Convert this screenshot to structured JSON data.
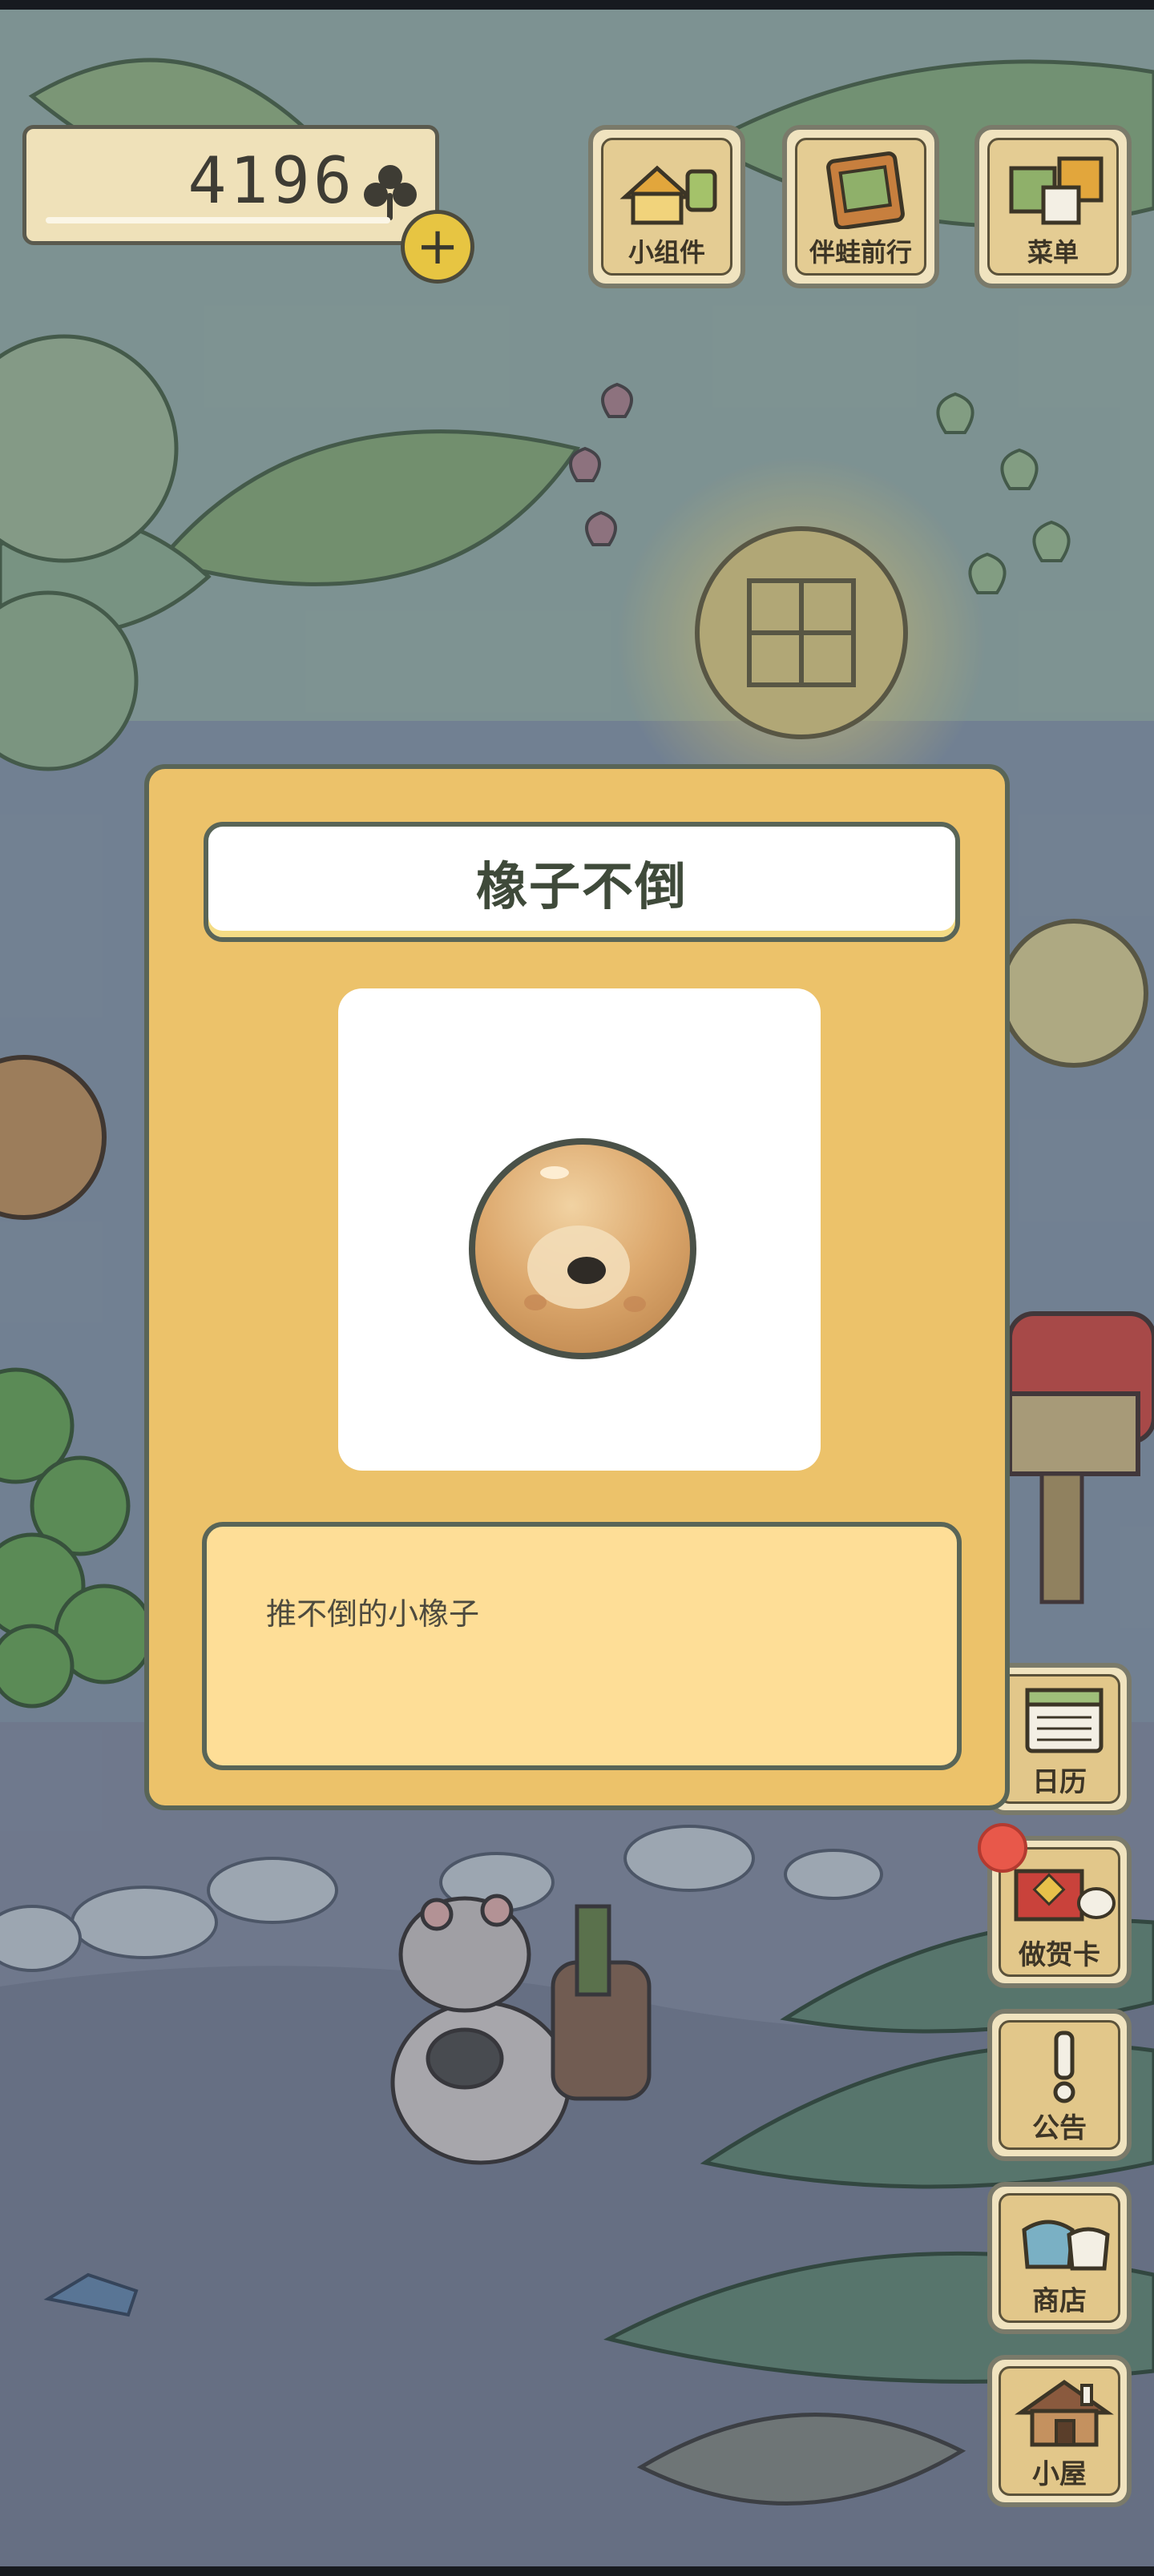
{
  "topbar": {
    "clover_count": "4196",
    "clover_icon": "clover-icon",
    "add_icon": "plus-icon",
    "buttons": [
      {
        "label": "小组件",
        "icon": "widget-icon"
      },
      {
        "label": "伴蛙前行",
        "icon": "photo-album-icon"
      },
      {
        "label": "菜单",
        "icon": "menu-cards-icon"
      }
    ]
  },
  "side_menu": {
    "items": [
      {
        "label": "日历",
        "icon": "calendar-icon",
        "badge": false
      },
      {
        "label": "做贺卡",
        "icon": "greeting-card-icon",
        "badge": true
      },
      {
        "label": "公告",
        "icon": "notice-icon",
        "badge": false
      },
      {
        "label": "商店",
        "icon": "shop-bags-icon",
        "badge": false
      },
      {
        "label": "小屋",
        "icon": "house-icon",
        "badge": false
      }
    ]
  },
  "item_dialog": {
    "title": "橡子不倒",
    "item_icon": "acorn-tumbler-icon",
    "description": "推不倒的小橡子"
  },
  "colors": {
    "dialog_bg": "#ecc26a",
    "dialog_border": "#596557",
    "description_bg": "#fede97",
    "badge": "#e8584a"
  }
}
